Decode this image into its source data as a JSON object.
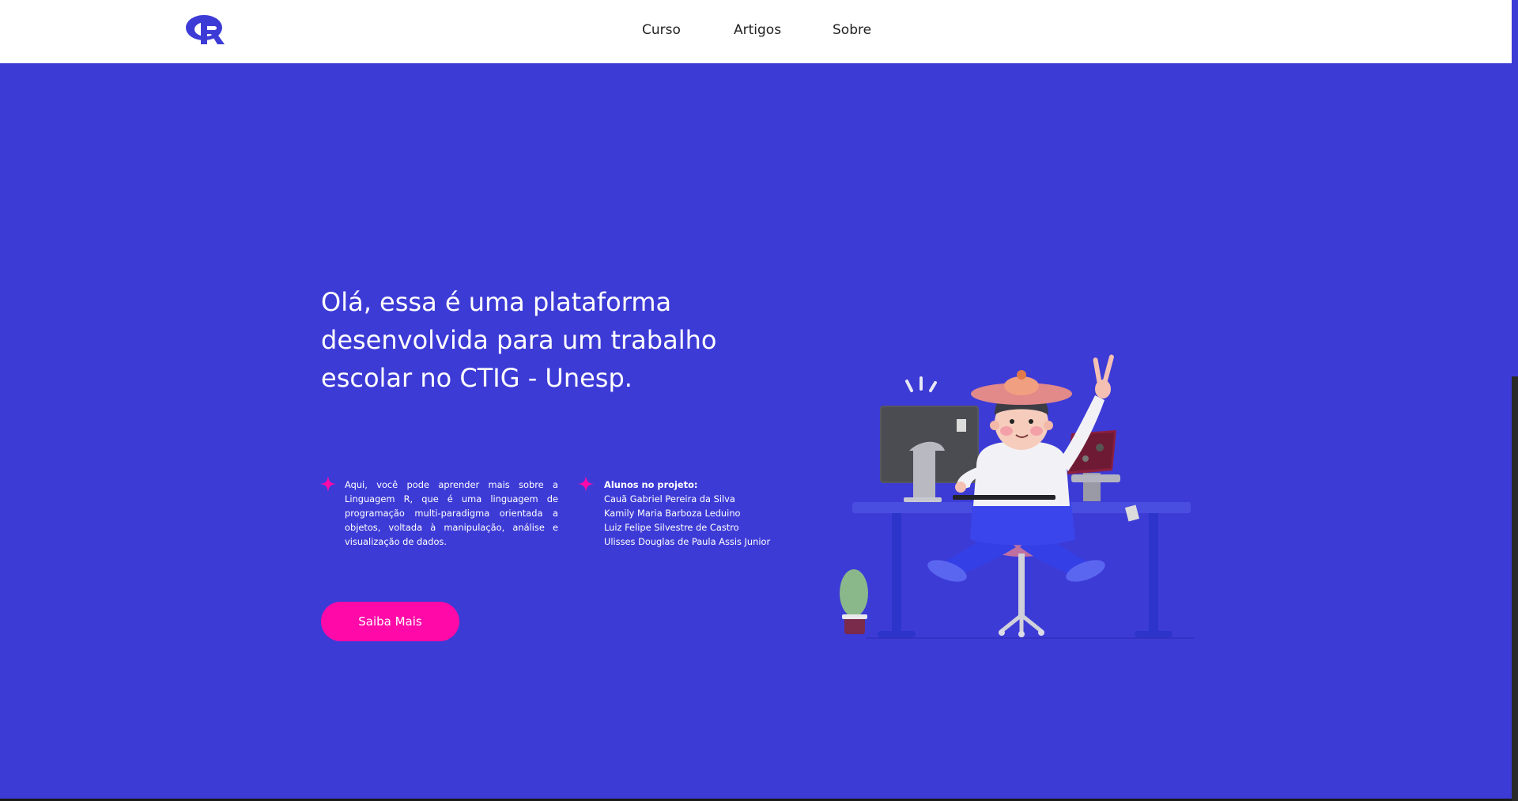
{
  "header": {
    "logo_icon": "r-language-logo-icon",
    "nav": [
      {
        "label": "Curso"
      },
      {
        "label": "Artigos"
      },
      {
        "label": "Sobre"
      }
    ]
  },
  "hero": {
    "headline": "Olá, essa é uma plataforma desenvolvida para um trabalho escolar no CTIG - Unesp.",
    "description": "Aqui, você pode aprender mais sobre a Linguagem R, que é uma linguagem de programação multi-paradigma orientada a objetos, voltada à manipulação, análise e visualização de dados.",
    "students_title": "Alunos no projeto:",
    "students": [
      "Cauã Gabriel Pereira da Silva",
      "Kamily Maria Barboza Leduino",
      "Luiz Felipe Silvestre de Castro",
      "Ulisses Douglas de Paula Assis Junior"
    ],
    "cta_label": "Saiba Mais",
    "bullet_icon": "sparkle-icon",
    "illustration": "person-at-desk-illustration"
  },
  "colors": {
    "hero_bg": "#3d3bd6",
    "accent": "#ff0aa8",
    "header_bg": "#ffffff",
    "nav_text": "#222222"
  }
}
